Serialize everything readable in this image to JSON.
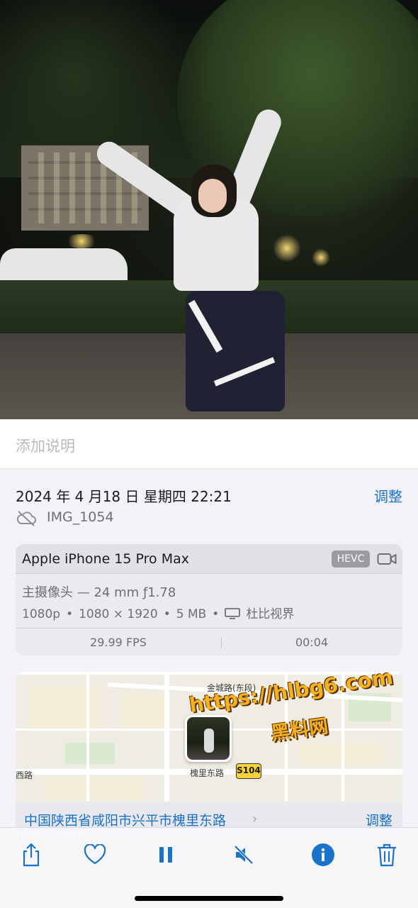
{
  "caption": {
    "placeholder": "添加说明"
  },
  "header": {
    "datetime": "2024 年 4 月18 日 星期四 22:21",
    "adjust_label": "调整",
    "filename": "IMG_1054"
  },
  "camera": {
    "device": "Apple iPhone 15 Pro Max",
    "codec_badge": "HEVC",
    "lens": "主摄像头 — 24 mm ƒ1.78",
    "resolution": "1080p",
    "dimensions": "1080 × 1920",
    "size": "5 MB",
    "hdr": "杜比视界",
    "fps": "29.99 FPS",
    "duration": "00:04"
  },
  "map": {
    "road_label_top": "金城路(东段)",
    "road_label_left": "西路",
    "road_label_bottom": "槐里东路",
    "highway_badge": "S104",
    "watermark_url": "https://hlbg6.com",
    "watermark_text": "黑料网"
  },
  "location": {
    "address": "中国陕西省咸阳市兴平市槐里东路",
    "adjust_label": "调整"
  },
  "toolbar": {
    "faint_text": "sitibg6....com"
  },
  "colors": {
    "accent": "#1a73c8",
    "background": "#f2f2f7"
  }
}
